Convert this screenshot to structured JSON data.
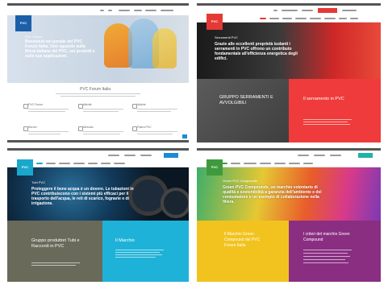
{
  "panel1": {
    "hero_title": "PVC Forum",
    "hero_text": "Benvenuti nel portale del PVC Forum Italia. Uno sguardo sulla filiera italiana del PVC, sui prodotti e sulle sue applicazioni.",
    "section_title": "PVC Forum Italia",
    "features": [
      "PVC Forum",
      "Attività",
      "Notizie",
      "Servizi",
      "Mercato",
      "Filiera PVC"
    ]
  },
  "panel2": {
    "hero_title": "Serramenti PVC",
    "hero_text": "Grazie alle eccellenti proprietà isolanti i serramenti in PVC offrono un contributo fondamentale all'efficienza energetica degli edifici.",
    "tile_left": "GRUPPO SERRAMENTI E AVVOLGIBILI",
    "tile_right": "Il serramento in PVC"
  },
  "panel3": {
    "hero_title": "Tubi PVC",
    "hero_text": "Proteggere il bene acqua è un dovere. Le tubazioni in PVC contribuiscono con i sistemi più efficaci per il trasporto dell'acqua, le reti di scarico, fognarie e di irrigazione.",
    "tile_left": "Gruppo produttori Tubi e Raccordi in PVC",
    "tile_right": "Il Marchio"
  },
  "panel4": {
    "hero_title": "Green PVC Compounds",
    "hero_text": "Green PVC Compounds, un marchio volontario di qualità e sostenibilità a garanzia dell'ambiente e del consumatore e un esempio di collaborazione nella filiera.",
    "tile_left": "Il Marchio Green Compound del PVC Forum Italia",
    "tile_right": "I criteri del marchio Green Compound"
  }
}
